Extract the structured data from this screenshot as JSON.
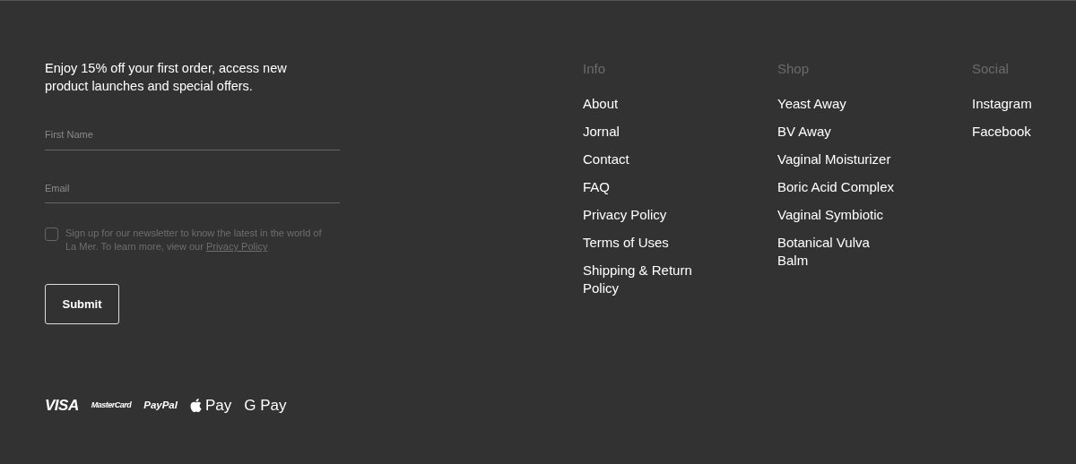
{
  "newsletter": {
    "intro": "Enjoy 15% off your first order, access new product launches and special offers.",
    "fields": [
      {
        "placeholder": "First Name"
      },
      {
        "placeholder": "Email"
      }
    ],
    "consent": {
      "checked": false,
      "text": "Sign up for our newsletter to know the latest in the world of La Mer. To learn more, view our ",
      "link": "Privacy Policy"
    },
    "submit": "Submit"
  },
  "link_columns": [
    {
      "heading": "Info",
      "links": [
        "About",
        "Jornal",
        "Contact",
        "FAQ",
        "Privacy Policy",
        "Terms of Uses",
        "Shipping & Return Policy"
      ]
    },
    {
      "heading": "Shop",
      "links": [
        "Yeast Away",
        "BV Away",
        "Vaginal Moisturizer",
        "Boric Acid Complex",
        "Vaginal Symbiotic",
        "Botanical Vulva Balm"
      ]
    },
    {
      "heading": "Social",
      "links": [
        "Instagram",
        "Facebook"
      ]
    }
  ],
  "payment_methods": [
    {
      "kind": "visa",
      "label": "VISA"
    },
    {
      "kind": "mastercard",
      "label": "MasterCard"
    },
    {
      "kind": "paypal",
      "label": "PayPal"
    },
    {
      "kind": "apple",
      "label": "Pay"
    },
    {
      "kind": "google",
      "label": "G Pay"
    }
  ]
}
